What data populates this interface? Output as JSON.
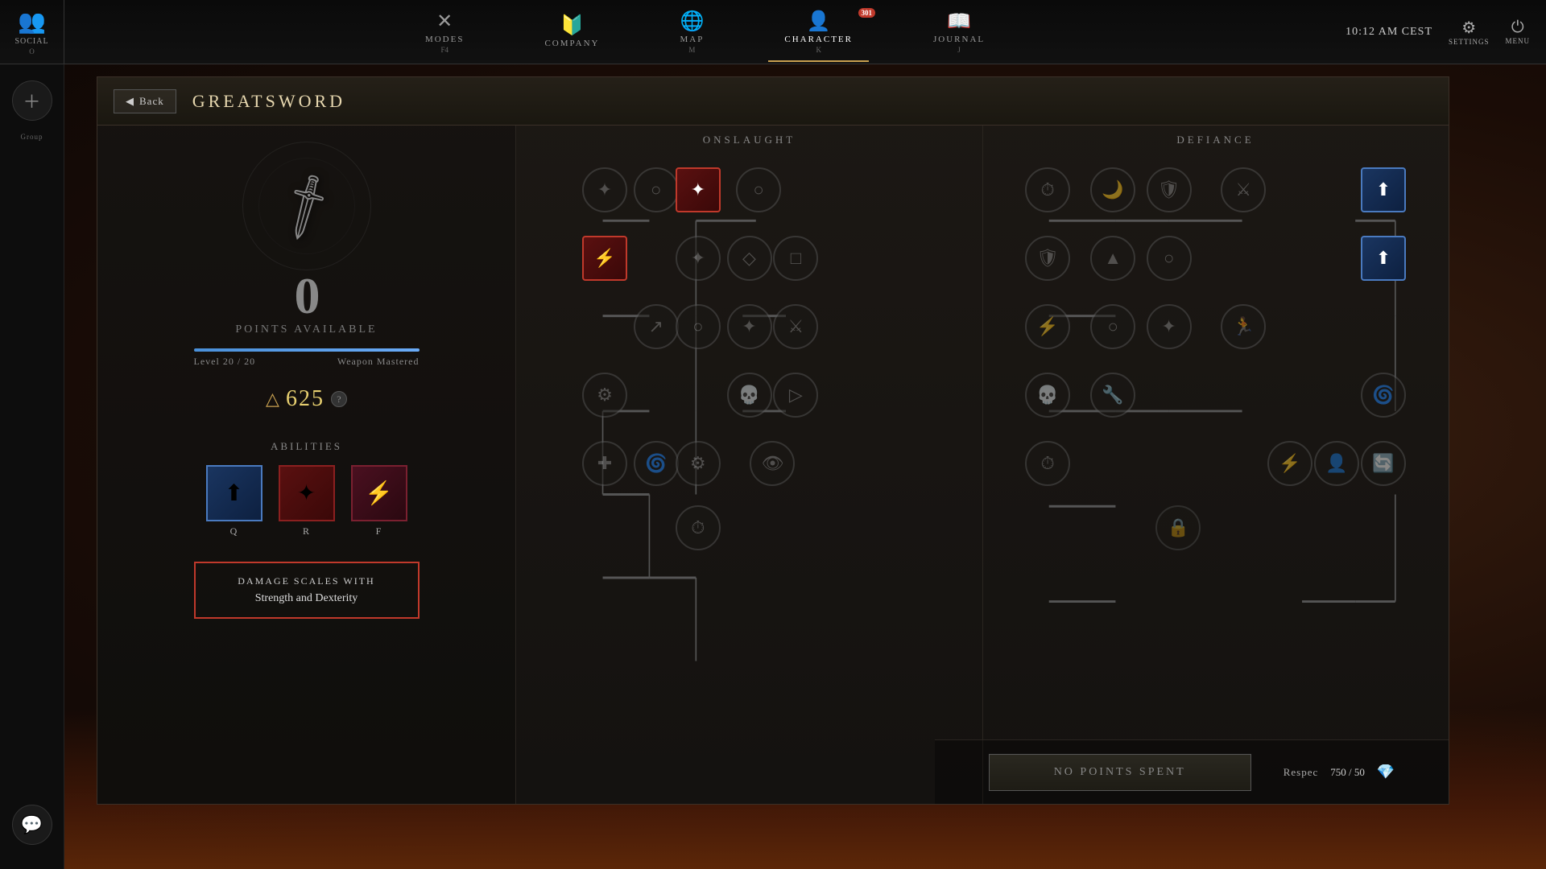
{
  "topbar": {
    "social_label": "SOCIAL",
    "social_key": "O",
    "time": "10:12 AM CEST",
    "nav_items": [
      {
        "label": "MODES",
        "key": "F4",
        "icon": "⚔",
        "active": false
      },
      {
        "label": "COMPANY",
        "key": "",
        "icon": "🛡",
        "active": false
      },
      {
        "label": "MAP",
        "key": "M",
        "icon": "🌐",
        "active": false
      },
      {
        "label": "CHARACTER",
        "key": "K",
        "icon": "👤",
        "active": true,
        "badge": "301"
      },
      {
        "label": "JOURNAL",
        "key": "J",
        "icon": "📖",
        "active": false
      }
    ],
    "settings_label": "SETTINGS",
    "menu_label": "MENU"
  },
  "panel": {
    "back_label": "Back",
    "title": "GREATSWORD",
    "points_available": "0",
    "points_label": "POINTS AVAILABLE",
    "level": "20",
    "max_level": "20",
    "mastery_label": "Weapon Mastered",
    "mastery_gems": "625",
    "abilities_label": "ABILITIES",
    "ability_keys": [
      "Q",
      "R",
      "F"
    ],
    "damage_scales_title": "DAMAGE SCALES WITH",
    "damage_scales_value": "Strength and Dexterity",
    "onslaught_label": "ONSLAUGHT",
    "defiance_label": "DEFIANCE",
    "no_points_label": "NO POINTS SPENT",
    "respec_label": "Respec",
    "respec_value": "750 / 50"
  }
}
